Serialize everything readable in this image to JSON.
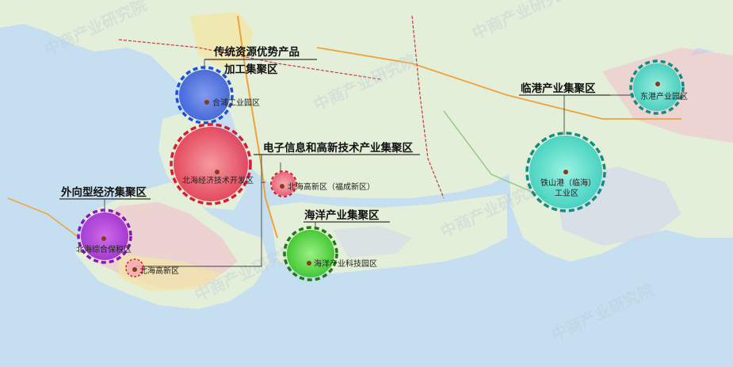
{
  "clusters": [
    {
      "id": "c-traditional",
      "title_line1": "传统资源优势产品",
      "title_line2": "加工集聚区",
      "zone": "合浦工业园区",
      "color": "#1f4fd6"
    },
    {
      "id": "c-electronic",
      "title_line1": "电子信息和高新技术产业集聚区",
      "zones": [
        "北海经济技术开发区",
        "北海高新区（福成新区）"
      ],
      "color": "#e0233a"
    },
    {
      "id": "c-export",
      "title_line1": "外向型经济集聚区",
      "zones": [
        "北海综合保税区",
        "北海高新区"
      ],
      "color": "#9a1fd0"
    },
    {
      "id": "c-marine",
      "title_line1": "海洋产业集聚区",
      "zone": "海洋产业科技园区",
      "color": "#2aa01a"
    },
    {
      "id": "c-port",
      "title_line1": "临港产业集聚区",
      "zones": [
        "东港产业园区",
        "铁山港（临海）工业区"
      ],
      "color": "#1aa6a0"
    }
  ],
  "watermark": "中商产业研究院",
  "colors": {
    "sea": "#c6dff0",
    "land": "#e4efd9",
    "urban_yellow": "#f3e6a6",
    "urban_pink": "#f2b9c9",
    "road": "#f0a23a",
    "rail": "#c9393c"
  }
}
